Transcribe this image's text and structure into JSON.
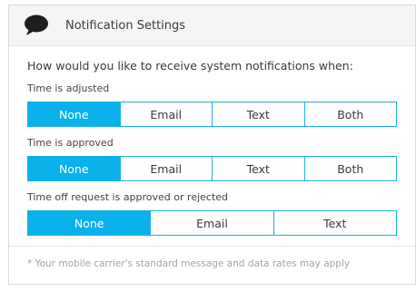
{
  "header": {
    "title": "Notification Settings",
    "icon": "speech-bubble-icon"
  },
  "question": "How would you like to receive system notifications when:",
  "groups": [
    {
      "label": "Time is adjusted",
      "options": [
        "None",
        "Email",
        "Text",
        "Both"
      ],
      "selected": "None"
    },
    {
      "label": "Time is approved",
      "options": [
        "None",
        "Email",
        "Text",
        "Both"
      ],
      "selected": "None"
    },
    {
      "label": "Time off request is approved or rejected",
      "options": [
        "None",
        "Email",
        "Text"
      ],
      "selected": "None"
    }
  ],
  "footnote": "* Your mobile carrier's standard message and data rates may apply",
  "colors": {
    "accent": "#0ab1ea",
    "border": "#19b0e6",
    "header_bg": "#f5f5f5"
  }
}
